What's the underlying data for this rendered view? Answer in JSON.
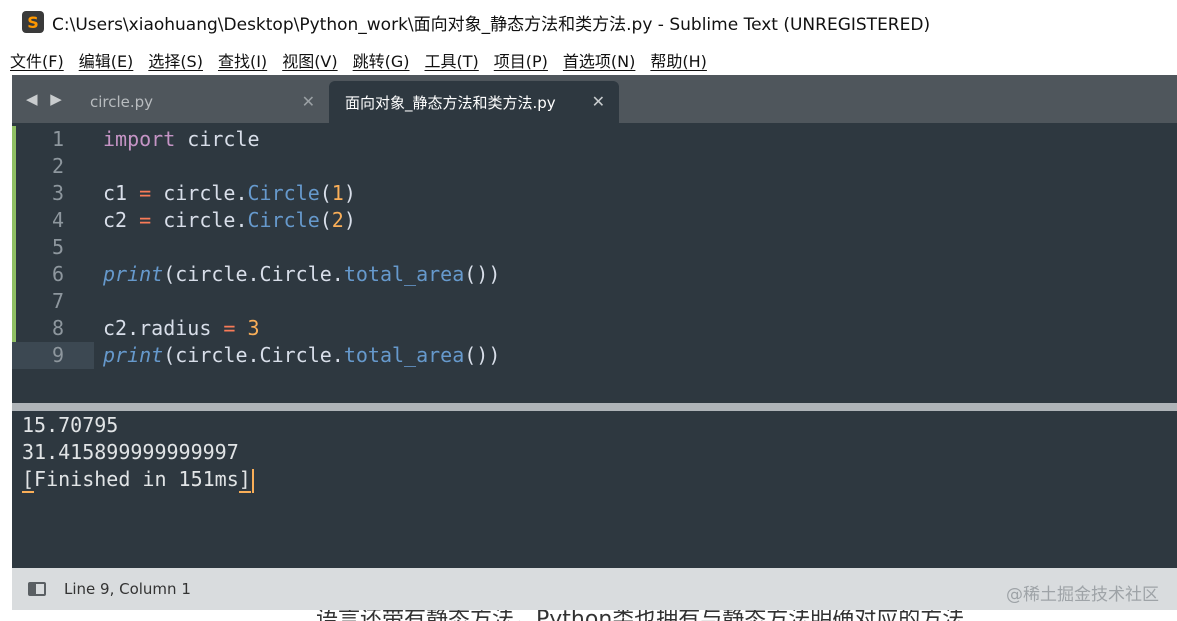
{
  "window": {
    "title": "C:\\Users\\xiaohuang\\Desktop\\Python_work\\面向对象_静态方法和类方法.py - Sublime Text (UNREGISTERED)",
    "app_icon": "S"
  },
  "menu": [
    "文件(F)",
    "编辑(E)",
    "选择(S)",
    "查找(I)",
    "视图(V)",
    "跳转(G)",
    "工具(T)",
    "项目(P)",
    "首选项(N)",
    "帮助(H)"
  ],
  "tabs": [
    {
      "label": "circle.py",
      "active": false
    },
    {
      "label": "面向对象_静态方法和类方法.py",
      "active": true
    }
  ],
  "nav_arrows": "◀ ▶",
  "close_glyph": "✕",
  "editor": {
    "line_numbers": [
      "1",
      "2",
      "3",
      "4",
      "5",
      "6",
      "7",
      "8",
      "9"
    ],
    "current_line": 9
  },
  "output": {
    "lines": [
      "15.70795",
      "31.415899999999997"
    ],
    "finished_open": "[",
    "finished_text": "Finished in 151ms",
    "finished_close": "]"
  },
  "status": {
    "position": "Line 9, Column 1"
  },
  "watermark": "@稀土掘金技术社区",
  "background_text": "语言还带有静态方法，Python类也拥有与静态方法明确对应的方法",
  "colors": {
    "editor_bg": "#2e3840",
    "keyword": "#c594c5",
    "operator": "#f97b58",
    "number": "#f9ae58",
    "function": "#6699cc",
    "modified_marker": "#8fbf63"
  }
}
